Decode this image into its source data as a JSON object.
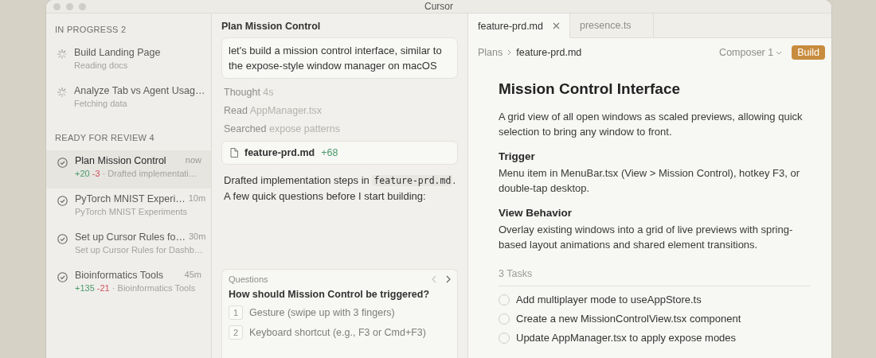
{
  "window": {
    "title": "Cursor"
  },
  "sidebar": {
    "sections": [
      {
        "heading": "IN PROGRESS 2",
        "items": [
          {
            "kind": "running",
            "title": "Build Landing Page",
            "subtitle": "Reading docs",
            "selected": false
          },
          {
            "kind": "running",
            "title": "Analyze Tab vs Agent Usag…",
            "subtitle": "Fetching data",
            "selected": false
          }
        ]
      },
      {
        "heading": "READY FOR REVIEW 4",
        "items": [
          {
            "kind": "done",
            "title": "Plan Mission Control",
            "time": "now",
            "added": "+20",
            "removed": "-3",
            "separator": "·",
            "subtitle": "Drafted implementati…",
            "selected": true
          },
          {
            "kind": "done",
            "title": "PyTorch MNIST Experi…",
            "time": "10m",
            "subtitle": "PyTorch MNIST Experiments",
            "selected": false
          },
          {
            "kind": "done",
            "title": "Set up Cursor Rules fo…",
            "time": "30m",
            "subtitle": "Set up Cursor Rules for Dashb…",
            "selected": false
          },
          {
            "kind": "done",
            "title": "Bioinformatics Tools",
            "time": "45m",
            "added": "+135",
            "removed": "-21",
            "separator": "·",
            "subtitle": "Bioinformatics Tools",
            "selected": false
          }
        ]
      }
    ]
  },
  "chat": {
    "title": "Plan Mission Control",
    "user_message": "let's build a mission control interface, similar to the expose-style window manager on macOS",
    "steps": [
      {
        "label": "Thought",
        "detail": "4s"
      },
      {
        "label": "Read",
        "detail": "AppManager.tsx"
      },
      {
        "label": "Searched",
        "detail": "expose patterns"
      }
    ],
    "file_card": {
      "name": "feature-prd.md",
      "added": "+68"
    },
    "reply": {
      "before": "Drafted implementation steps in",
      "code": "feature-prd.md",
      "after": ". A few quick questions before I start building:"
    },
    "questions": {
      "label": "Questions",
      "question": "How should Mission Control be triggered?",
      "options": [
        {
          "number": "1",
          "text": "Gesture (swipe up with 3 fingers)"
        },
        {
          "number": "2",
          "text": "Keyboard shortcut (e.g., F3 or Cmd+F3)"
        }
      ]
    }
  },
  "editor": {
    "tabs": [
      {
        "label": "feature-prd.md",
        "selected": true
      },
      {
        "label": "presence.ts",
        "selected": false
      }
    ],
    "breadcrumb": [
      "Plans",
      "feature-prd.md"
    ],
    "model": "Composer 1",
    "build_button": "Build",
    "doc": {
      "title": "Mission Control Interface",
      "intro": "A grid view of all open windows as scaled previews, allowing quick selection to bring any window to front.",
      "sections": [
        {
          "heading": "Trigger",
          "body": "Menu item in MenuBar.tsx (View > Mission Control), hotkey F3, or double-tap desktop."
        },
        {
          "heading": "View Behavior",
          "body": "Overlay existing windows into a grid of live previews with spring-based layout animations and shared element transitions."
        }
      ],
      "tasks_label": "3 Tasks",
      "tasks": [
        {
          "text": "Add multiplayer mode to useAppStore.ts",
          "checked": false
        },
        {
          "text": "Create a new MissionControlView.tsx component",
          "checked": false
        },
        {
          "text": "Update AppManager.tsx to apply expose modes",
          "checked": false
        }
      ]
    }
  }
}
